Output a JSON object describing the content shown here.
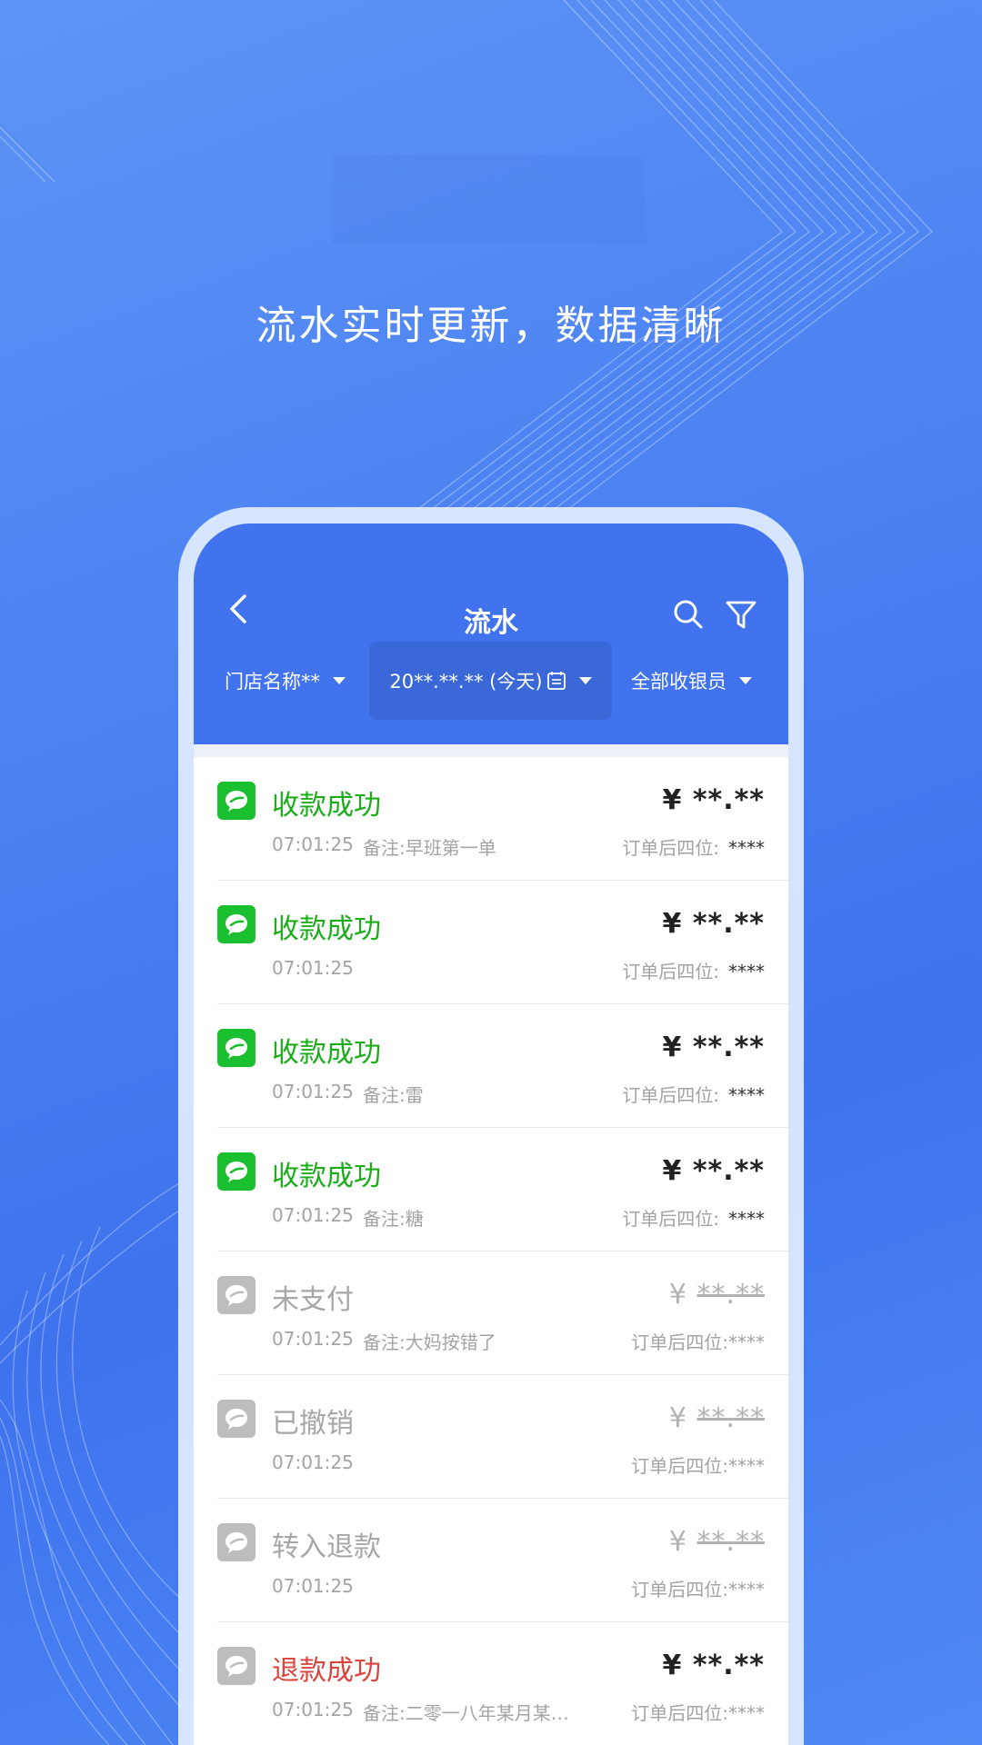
{
  "headline": "流水实时更新，数据清晰",
  "appbar": {
    "title": "流水",
    "back_icon": "chevron-left-icon",
    "search_icon": "search-icon",
    "filter_icon": "funnel-icon",
    "color": "#4173ee"
  },
  "filters": {
    "store": "门店名称**",
    "date": "20**.**.** (今天)",
    "cashier": "全部收银员"
  },
  "transactions": [
    {
      "status": "收款成功",
      "amount_symbol": "¥",
      "amount": "**.**",
      "time": "07:01:25",
      "note": "备注:早班第一单",
      "order_label": "订单后四位:",
      "order_value": "****",
      "state": "success"
    },
    {
      "status": "收款成功",
      "amount_symbol": "¥",
      "amount": "**.**",
      "time": "07:01:25",
      "note": "",
      "order_label": "订单后四位:",
      "order_value": "****",
      "state": "success"
    },
    {
      "status": "收款成功",
      "amount_symbol": "¥",
      "amount": "**.**",
      "time": "07:01:25",
      "note": "备注:雷",
      "order_label": "订单后四位:",
      "order_value": "****",
      "state": "success"
    },
    {
      "status": "收款成功",
      "amount_symbol": "¥",
      "amount": "**.**",
      "time": "07:01:25",
      "note": "备注:糖",
      "order_label": "订单后四位:",
      "order_value": "****",
      "state": "success"
    },
    {
      "status": "未支付",
      "amount_symbol": "¥",
      "amount": "**.**",
      "time": "07:01:25",
      "note": "备注:大妈按错了",
      "order_label": "订单后四位:",
      "order_value": "****",
      "state": "inactive"
    },
    {
      "status": "已撤销",
      "amount_symbol": "¥",
      "amount": "**.**",
      "time": "07:01:25",
      "note": "",
      "order_label": "订单后四位:",
      "order_value": "****",
      "state": "inactive"
    },
    {
      "status": "转入退款",
      "amount_symbol": "¥",
      "amount": "**.**",
      "time": "07:01:25",
      "note": "",
      "order_label": "订单后四位:",
      "order_value": "****",
      "state": "inactive"
    },
    {
      "status": "退款成功",
      "amount_symbol": "¥",
      "amount": "**.**",
      "time": "07:01:25",
      "note": "备注:二零一八年某月某…",
      "order_label": "订单后四位:",
      "order_value": "****",
      "state": "refund"
    }
  ],
  "colors": {
    "success": "#1aad19",
    "inactive": "#a6a6a6",
    "refund": "#d9443d",
    "wechat_green": "#1ac02f"
  }
}
